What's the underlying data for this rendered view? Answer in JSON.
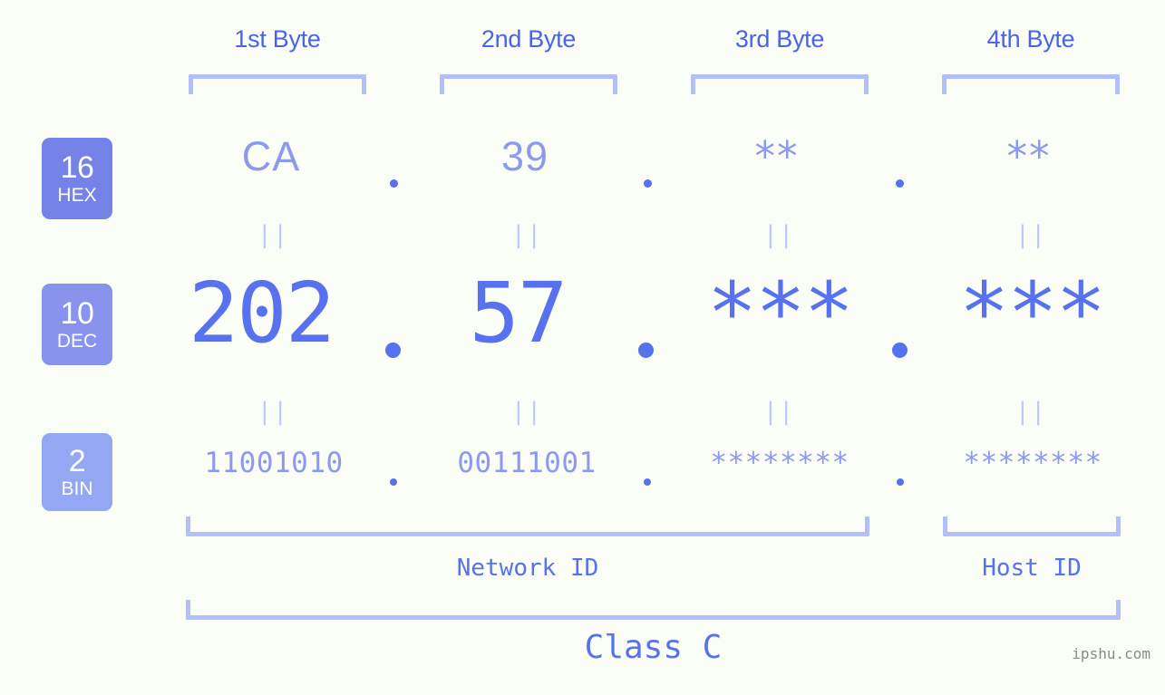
{
  "meta": {
    "background_color": "#fbfdf7",
    "accent_color": "#5871ee",
    "light_accent_color": "#8b9aee",
    "bracket_color": "#b3c0f7",
    "watermark": "ipshu.com"
  },
  "headers": [
    {
      "label": "1st Byte"
    },
    {
      "label": "2nd Byte"
    },
    {
      "label": "3rd Byte"
    },
    {
      "label": "4th Byte"
    }
  ],
  "bases": [
    {
      "num": "16",
      "name": "HEX",
      "color": "#7582e8"
    },
    {
      "num": "10",
      "name": "DEC",
      "color": "#8793ec"
    },
    {
      "num": "2",
      "name": "BIN",
      "color": "#93a7f2"
    }
  ],
  "rows": {
    "hex": {
      "b1": "CA",
      "b2": "39",
      "b3": "**",
      "b4": "**"
    },
    "dec": {
      "b1": "202",
      "b2": "57",
      "b3": "***",
      "b4": "***"
    },
    "bin": {
      "b1": "11001010",
      "b2": "00111001",
      "b3": "********",
      "b4": "********"
    }
  },
  "equals": {
    "mark": "||"
  },
  "separator": {
    "dot": "."
  },
  "footer": {
    "network_id": "Network ID",
    "host_id": "Host ID",
    "class": "Class C"
  }
}
